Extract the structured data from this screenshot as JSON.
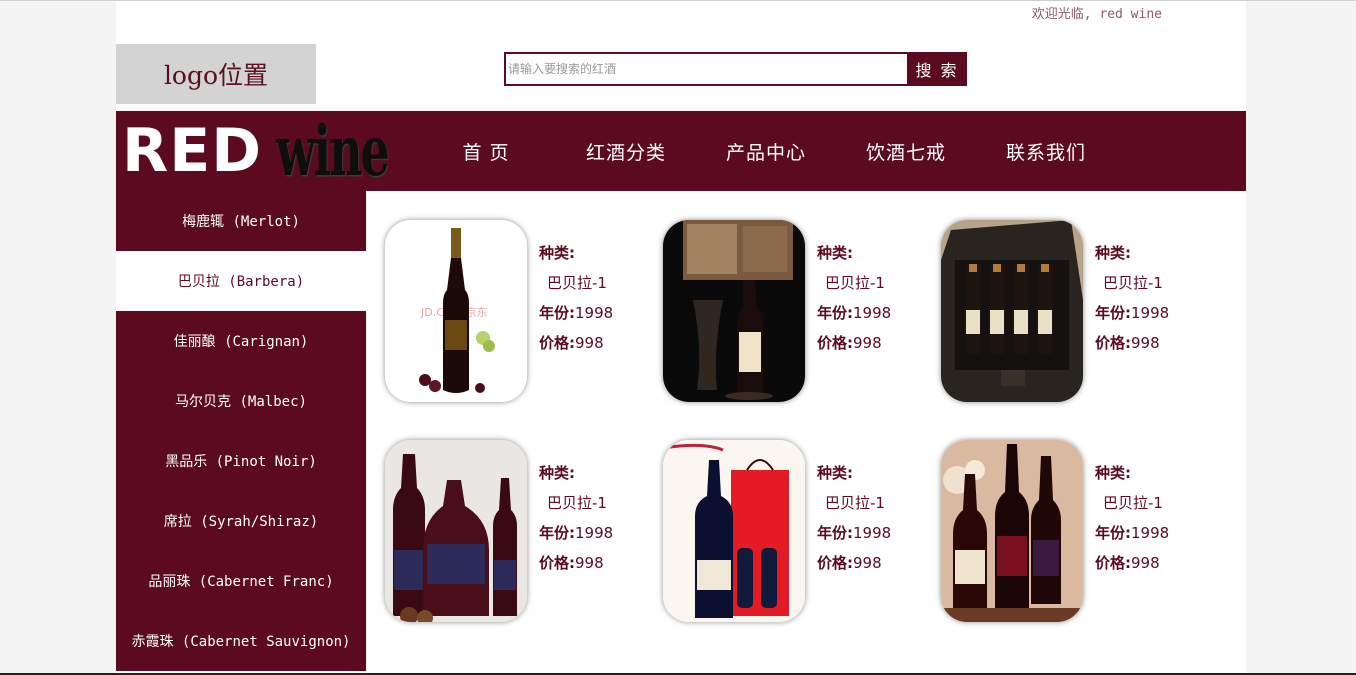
{
  "header": {
    "welcome": "欢迎光临, red wine",
    "logo": "logo位置"
  },
  "search": {
    "placeholder": "请输入要搜索的红酒",
    "button": "搜 索"
  },
  "brand": {
    "red": "RED",
    "wine": "wine"
  },
  "nav": {
    "items": [
      "首 页",
      "红酒分类",
      "产品中心",
      "饮酒七戒",
      "联系我们"
    ]
  },
  "sidebar": {
    "items": [
      "梅鹿辄 (Merlot)",
      "巴贝拉 (Barbera)",
      "佳丽酿 (Carignan)",
      "马尔贝克 (Malbec)",
      "黑品乐 (Pinot Noir)",
      "席拉 (Syrah/Shiraz)",
      "品丽珠 (Cabernet Franc)",
      "赤霞珠 (Cabernet Sauvignon)"
    ],
    "active_index": 1
  },
  "products": {
    "label_type": "种类:",
    "label_year": "年份:",
    "label_price": "价格:",
    "items": [
      {
        "variety": "巴贝拉-1",
        "year": "1998",
        "price": "998"
      },
      {
        "variety": "巴贝拉-1",
        "year": "1998",
        "price": "998"
      },
      {
        "variety": "巴贝拉-1",
        "year": "1998",
        "price": "998"
      },
      {
        "variety": "巴贝拉-1",
        "year": "1998",
        "price": "998"
      },
      {
        "variety": "巴贝拉-1",
        "year": "1998",
        "price": "998"
      },
      {
        "variety": "巴贝拉-1",
        "year": "1998",
        "price": "998"
      }
    ],
    "watermark": "JD.COM 京东"
  },
  "colors": {
    "brand": "#5c0a1f",
    "logo_bg": "#d3d3d3"
  }
}
